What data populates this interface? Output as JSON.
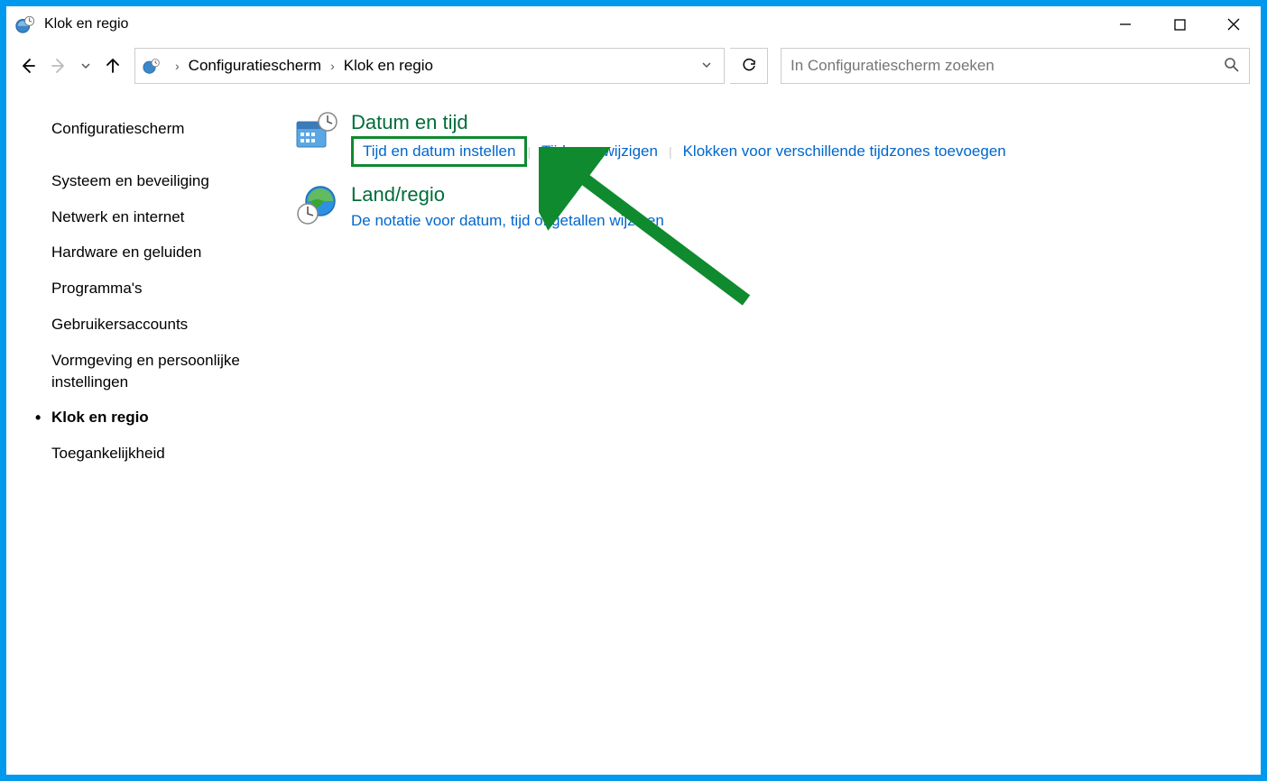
{
  "window": {
    "title": "Klok en regio"
  },
  "address": {
    "crumbs": [
      "Configuratiescherm",
      "Klok en regio"
    ],
    "search_placeholder": "In Configuratiescherm zoeken"
  },
  "sidebar": {
    "home": "Configuratiescherm",
    "items": [
      "Systeem en beveiliging",
      "Netwerk en internet",
      "Hardware en geluiden",
      "Programma's",
      "Gebruikersaccounts",
      "Vormgeving en persoonlijke instellingen",
      "Klok en regio",
      "Toegankelijkheid"
    ],
    "active_index": 6
  },
  "categories": [
    {
      "title": "Datum en tijd",
      "links": [
        "Tijd en datum instellen",
        "Tijdzone wijzigen",
        "Klokken voor verschillende tijdzones toevoegen"
      ]
    },
    {
      "title": "Land/regio",
      "links": [
        "De notatie voor datum, tijd of getallen wijzigen"
      ]
    }
  ],
  "highlighted_link": {
    "category": 0,
    "link": 0
  }
}
